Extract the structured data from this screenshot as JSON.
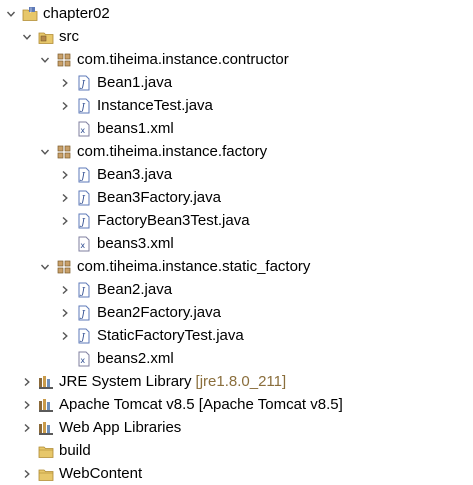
{
  "tree": {
    "project": {
      "label": "chapter02",
      "expanded": true
    },
    "src": {
      "label": "src",
      "expanded": true
    },
    "pkg1": {
      "label": "com.tiheima.instance.contructor",
      "files": [
        "Bean1.java",
        "InstanceTest.java",
        "beans1.xml"
      ]
    },
    "pkg2": {
      "label": "com.tiheima.instance.factory",
      "files": [
        "Bean3.java",
        "Bean3Factory.java",
        "FactoryBean3Test.java",
        "beans3.xml"
      ]
    },
    "pkg3": {
      "label": "com.tiheima.instance.static_factory",
      "files": [
        "Bean2.java",
        "Bean2Factory.java",
        "StaticFactoryTest.java",
        "beans2.xml"
      ]
    },
    "jre": {
      "label": "JRE System Library",
      "decoration": "[jre1.8.0_211]"
    },
    "tomcat": {
      "label": "Apache Tomcat v8.5 [Apache Tomcat v8.5]"
    },
    "webapp": {
      "label": "Web App Libraries"
    },
    "build": {
      "label": "build"
    },
    "webcontent": {
      "label": "WebContent"
    }
  },
  "colors": {
    "java_icon": "#5e7ab8",
    "package_icon": "#b5884a",
    "folder_icon": "#e7c76a",
    "decoration": "#8a6e3c"
  },
  "icons": {
    "project": "java-project-icon",
    "src": "source-folder-icon",
    "package": "package-icon",
    "java": "java-file-icon",
    "xml": "xml-file-icon",
    "library": "library-icon",
    "folder": "folder-icon"
  }
}
